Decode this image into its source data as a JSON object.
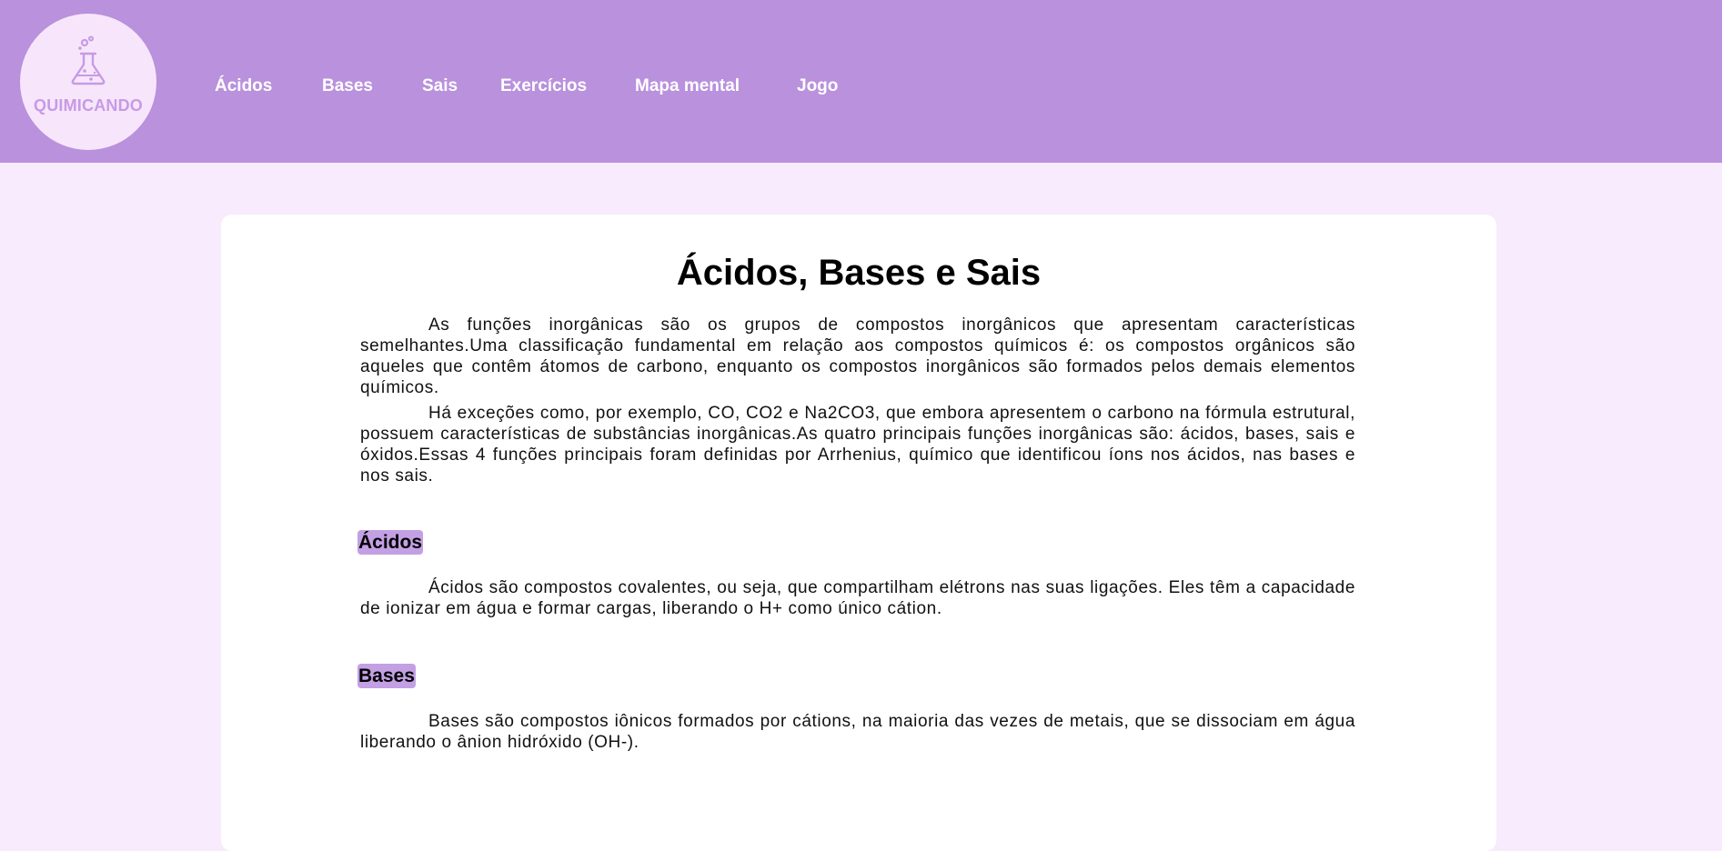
{
  "header": {
    "logo_text": "QUIMICANDO",
    "logo_icon": "flask-icon",
    "nav": [
      "Ácidos",
      "Bases",
      "Sais",
      "Exercícios",
      "Mapa mental",
      "Jogo"
    ]
  },
  "colors": {
    "header_bg": "#b991dc",
    "page_bg": "#f8ebfd",
    "card_bg": "#ffffff",
    "highlight": "#c3a0e4"
  },
  "main": {
    "title": "Ácidos, Bases e Sais",
    "intro": [
      "As funções inorgânicas são os grupos de compostos inorgânicos que apresentam características semelhantes.Uma classificação fundamental em relação aos compostos químicos é: os compostos orgânicos são aqueles que contêm átomos de carbono, enquanto os compostos inorgânicos são formados pelos demais elementos químicos.",
      "Há exceções como, por exemplo, CO, CO2 e Na2CO3, que embora apresentem o carbono na fórmula estrutural, possuem características de substâncias inorgânicas.As quatro principais funções inorgânicas são: ácidos, bases, sais e óxidos.Essas 4 funções principais foram definidas por Arrhenius, químico que identificou íons nos ácidos, nas bases e nos sais."
    ],
    "sections": [
      {
        "heading": "Ácidos",
        "text": "Ácidos são compostos covalentes, ou seja, que compartilham elétrons nas suas ligações. Eles têm a capacidade de ionizar em água e formar cargas, liberando o H+ como único cátion."
      },
      {
        "heading": "Bases",
        "text": "Bases são compostos iônicos formados por cátions, na maioria das vezes de metais, que se dissociam em água liberando o ânion hidróxido (OH-)."
      }
    ]
  }
}
